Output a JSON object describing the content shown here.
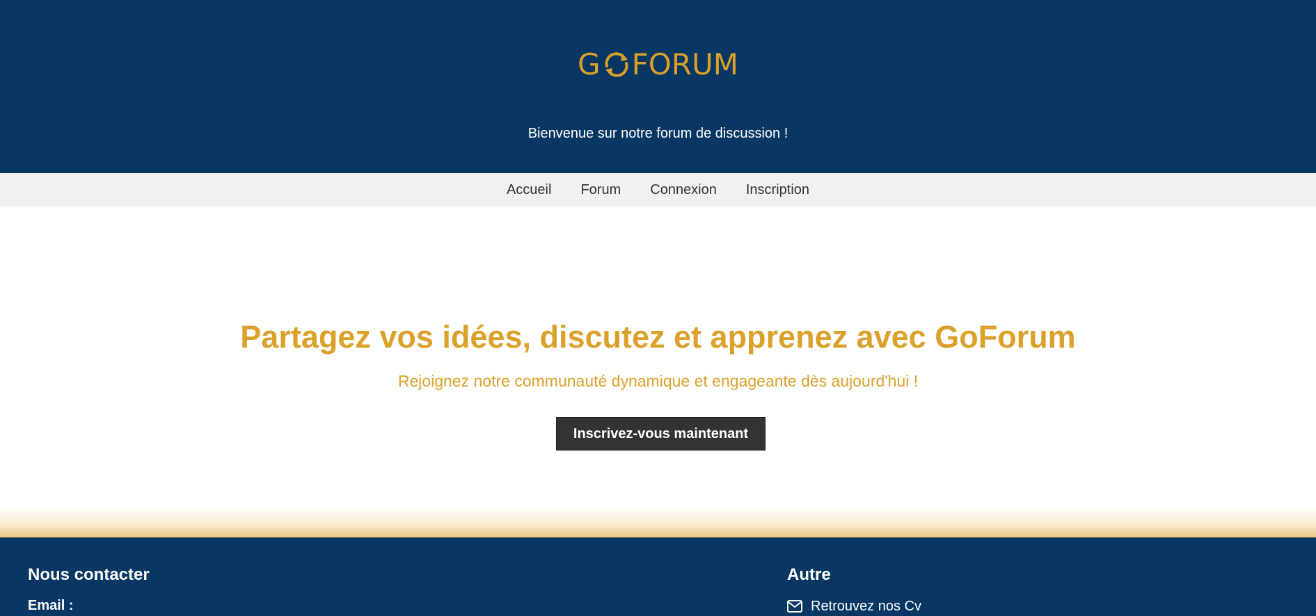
{
  "header": {
    "logo_text": "GOFORUM",
    "logo_letter_g": "G",
    "logo_rest": "FORUM",
    "welcome": "Bienvenue sur notre forum de discussion !"
  },
  "nav": {
    "items": [
      {
        "label": "Accueil"
      },
      {
        "label": "Forum"
      },
      {
        "label": "Connexion"
      },
      {
        "label": "Inscription"
      }
    ]
  },
  "hero": {
    "title": "Partagez vos idées, discutez et apprenez avec GoForum",
    "subtitle": "Rejoignez notre communauté dynamique et engageante dès aujourd'hui !",
    "cta_label": "Inscrivez-vous maintenant"
  },
  "footer": {
    "contact_title": "Nous contacter",
    "email_label": "Email :",
    "other_title": "Autre",
    "cv_link": "Retrouvez nos Cv",
    "cv_icon": "envelope-icon"
  },
  "colors": {
    "primary": "#083764",
    "accent": "#dba12b",
    "nav_bg": "#f1f1f1",
    "button_bg": "#333333"
  }
}
